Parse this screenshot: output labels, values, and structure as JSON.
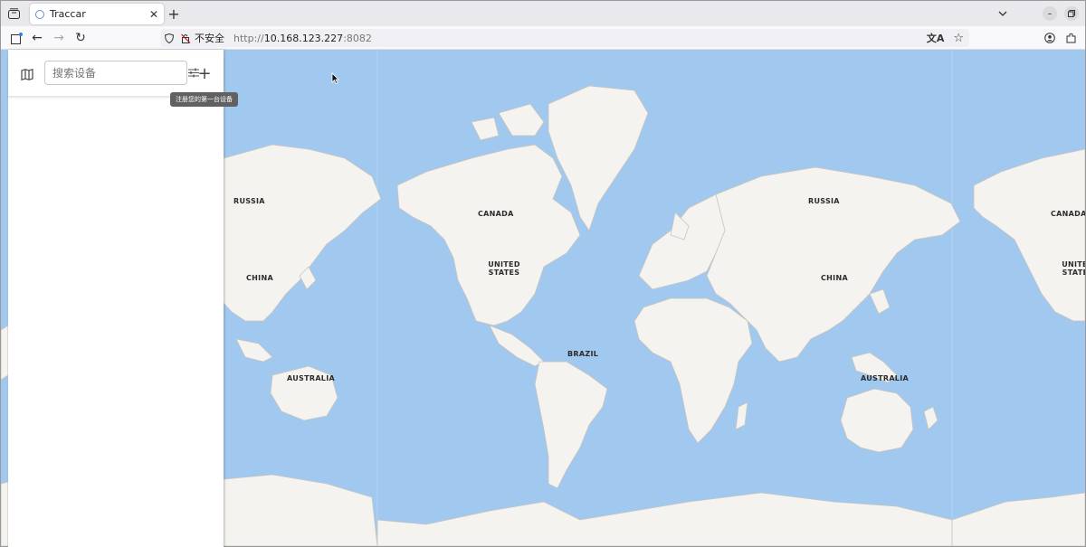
{
  "browser": {
    "tab_title": "Traccar",
    "url_protocol": "http://",
    "url_host": "10.168.123.227",
    "url_port": ":8082",
    "security_label": "不安全"
  },
  "panel": {
    "search_placeholder": "搜索设备",
    "add_tooltip": "注册您的第一台设备"
  },
  "map": {
    "labels": {
      "russia_left": "RUSSIA",
      "china_left": "CHINA",
      "australia_left": "AUSTRALIA",
      "canada": "CANADA",
      "united_states": "UNITED STATES",
      "brazil": "BRAZIL",
      "russia": "RUSSIA",
      "china": "CHINA",
      "australia": "AUSTRALIA",
      "canada_right": "CANADA",
      "united_states_right": "UNITED STATES"
    }
  },
  "colors": {
    "ocean": "#a1c8ef",
    "land": "#f5f3ef"
  }
}
